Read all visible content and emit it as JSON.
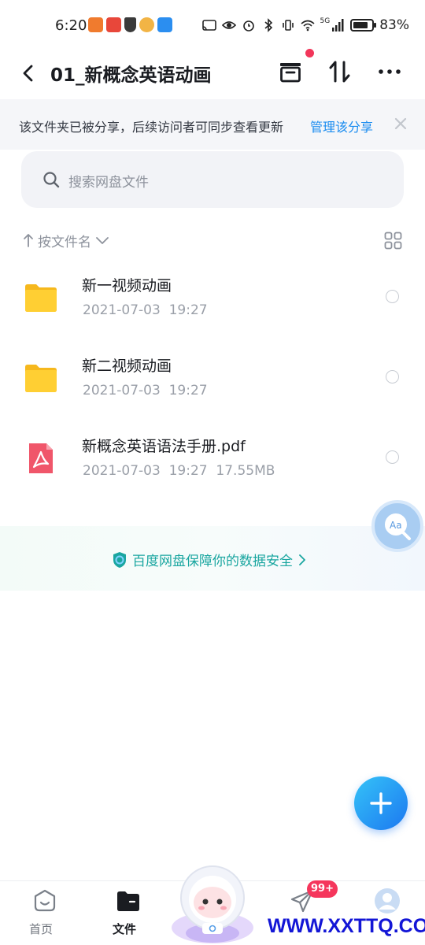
{
  "status_bar": {
    "time": "6:20",
    "network": "5G",
    "battery": "83%",
    "battery_level": 0.83
  },
  "header": {
    "title": "01_新概念英语动画"
  },
  "share_banner": {
    "text": "该文件夹已被分享，后续访问者可同步查看更新",
    "link": "管理该分享"
  },
  "search": {
    "placeholder": "搜索网盘文件"
  },
  "sort": {
    "label": "按文件名"
  },
  "files": [
    {
      "name": "新一视频动画",
      "date": "2021-07-03",
      "time": "19:27",
      "size": "",
      "type": "folder"
    },
    {
      "name": "新二视频动画",
      "date": "2021-07-03",
      "time": "19:27",
      "size": "",
      "type": "folder"
    },
    {
      "name": "新概念英语语法手册.pdf",
      "date": "2021-07-03",
      "time": "19:27",
      "size": "17.55MB",
      "type": "pdf"
    }
  ],
  "security": {
    "text": "百度网盘保障你的数据安全"
  },
  "bottom_nav": {
    "home": "首页",
    "files": "文件"
  },
  "badge": "99+",
  "watermark": "WWW.XXTTQ.COM",
  "colors": {
    "accent": "#1a8cf0",
    "security": "#1aa6a0",
    "folder": "#ffc928",
    "pdf": "#f0566a",
    "badge": "#f5365c"
  }
}
